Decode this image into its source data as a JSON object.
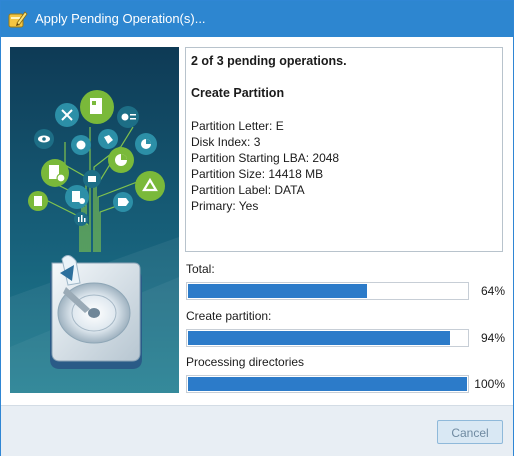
{
  "window": {
    "title": "Apply Pending Operation(s)..."
  },
  "info": {
    "count_text": "2 of 3 pending operations.",
    "operation": "Create Partition",
    "details": [
      "Partition Letter: E",
      "Disk Index: 3",
      "Partition Starting LBA: 2048",
      "Partition Size: 14418 MB",
      "Partition Label: DATA",
      "Primary: Yes"
    ]
  },
  "progress": [
    {
      "label": "Total:",
      "percent_text": "64%",
      "value": 0.64
    },
    {
      "label": "Create partition:",
      "percent_text": "94%",
      "value": 0.94
    },
    {
      "label": "Processing directories",
      "percent_text": "100%",
      "value": 1.0
    }
  ],
  "footer": {
    "cancel_label": "Cancel"
  },
  "colors": {
    "titlebar": "#2d86d0",
    "bar_fill": "#2c7bc9",
    "art_bg_dark": "#0f3c52",
    "art_bg_light": "#1f7b90",
    "node_green": "#7ab93a",
    "node_teal": "#2c8fa7"
  },
  "icons": {
    "title": "pencil-on-disk-icon",
    "art": "disk-with-data-tree-illustration"
  }
}
